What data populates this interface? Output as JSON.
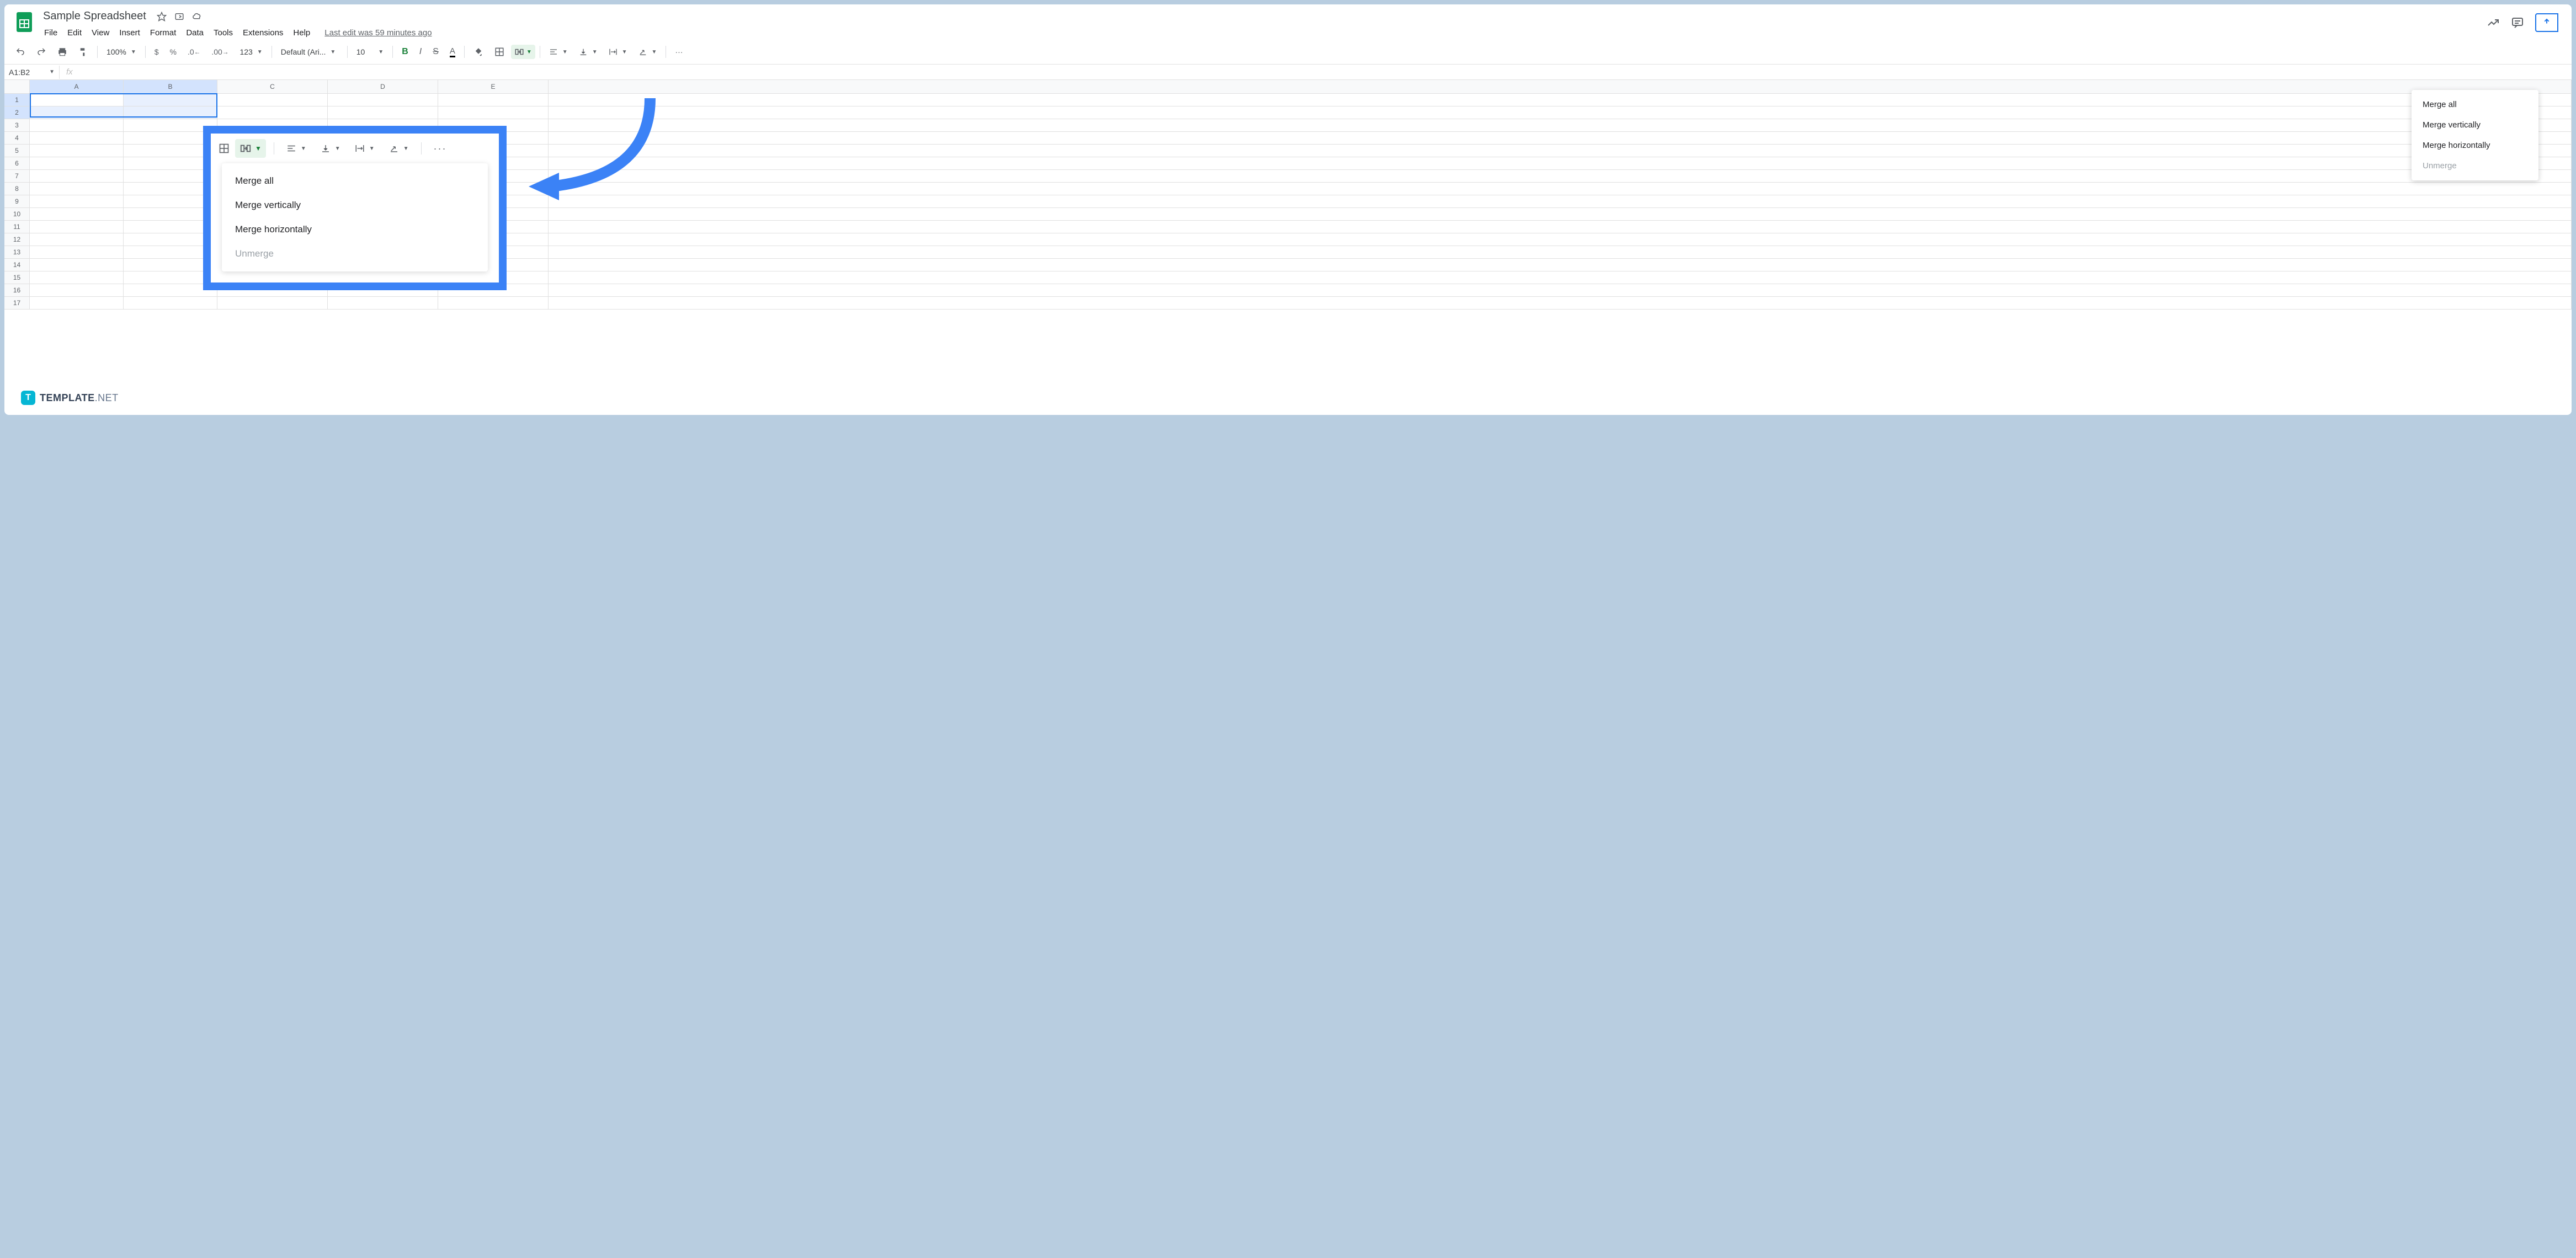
{
  "doc": {
    "title": "Sample Spreadsheet",
    "last_edit": "Last edit was 59 minutes ago"
  },
  "menus": {
    "file": "File",
    "edit": "Edit",
    "view": "View",
    "insert": "Insert",
    "format": "Format",
    "data": "Data",
    "tools": "Tools",
    "extensions": "Extensions",
    "help": "Help"
  },
  "toolbar": {
    "zoom": "100%",
    "currency": "$",
    "percent": "%",
    "dec_dec": ".0",
    "inc_dec": ".00",
    "num_fmt": "123",
    "font": "Default (Ari...",
    "font_size": "10",
    "bold": "B",
    "italic": "I",
    "strike": "S",
    "more": "···"
  },
  "formula": {
    "name_box": "A1:B2",
    "fx": "fx"
  },
  "columns": [
    "A",
    "B",
    "C",
    "D",
    "E"
  ],
  "rows": [
    "1",
    "2",
    "3",
    "4",
    "5",
    "6",
    "7",
    "8",
    "9",
    "10",
    "11",
    "12",
    "13",
    "14",
    "15",
    "16",
    "17"
  ],
  "merge_menu": {
    "all": "Merge all",
    "vertical": "Merge vertically",
    "horizontal": "Merge horizontally",
    "unmerge": "Unmerge"
  },
  "watermark": {
    "brand_bold": "TEMPLATE",
    "brand_light": ".NET",
    "icon_letter": "T"
  }
}
